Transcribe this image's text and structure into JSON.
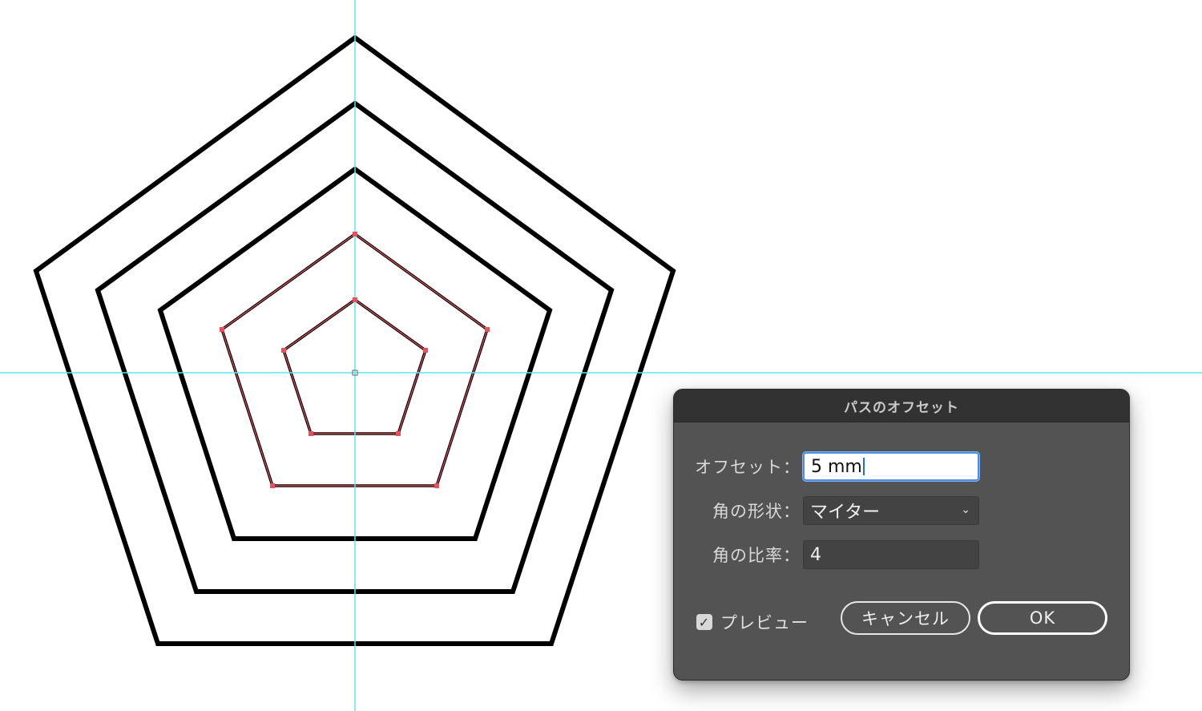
{
  "dialog": {
    "title": "パスのオフセット",
    "offset_label": "オフセット：",
    "offset_value": "5 mm",
    "join_label": "角の形状：",
    "join_value": "マイター",
    "miter_label": "角の比率：",
    "miter_value": "4",
    "preview_label": "プレビュー",
    "preview_checked": true,
    "cancel_label": "キャンセル",
    "ok_label": "OK"
  },
  "canvas": {
    "guide_color": "#5ee6ee",
    "path_color": "#000000",
    "selection_color": "#e8505a",
    "selected_paths": 2,
    "total_paths": 5
  }
}
